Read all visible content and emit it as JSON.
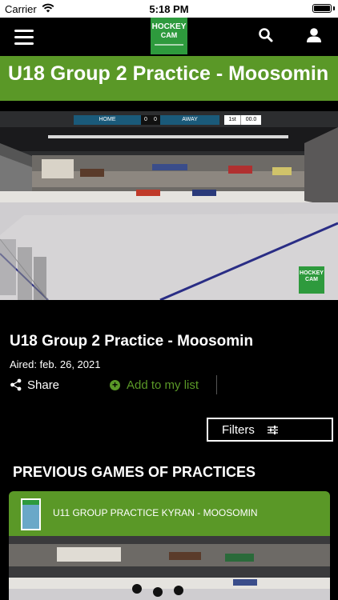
{
  "status_bar": {
    "carrier": "Carrier",
    "time": "5:18 PM"
  },
  "nav": {
    "logo_line1": "HOCKEY",
    "logo_line2": "CAM",
    "icons": [
      "menu-icon",
      "search-icon",
      "user-icon"
    ]
  },
  "page": {
    "title": "U18 Group 2 Practice - Moosomin"
  },
  "video": {
    "scoreboard": {
      "home": "HOME",
      "home_score": "0",
      "away_score": "0",
      "away": "AWAY",
      "period": "1st",
      "clock": "00.0"
    },
    "watermark_line1": "HOCKEY",
    "watermark_line2": "CAM"
  },
  "game": {
    "title": "U18 Group 2 Practice - Moosomin",
    "aired": "Aired: feb. 26, 2021",
    "share_label": "Share",
    "add_list_label": "Add to my list"
  },
  "filters": {
    "label": "Filters"
  },
  "previous": {
    "section_title": "PREVIOUS GAMES OF PRACTICES",
    "items": [
      {
        "title": "U11 GROUP PRACTICE KYRAN - MOOSOMIN"
      }
    ]
  },
  "colors": {
    "brand_green": "#5a9827",
    "logo_green": "#2e9a3d",
    "background": "#000000"
  }
}
